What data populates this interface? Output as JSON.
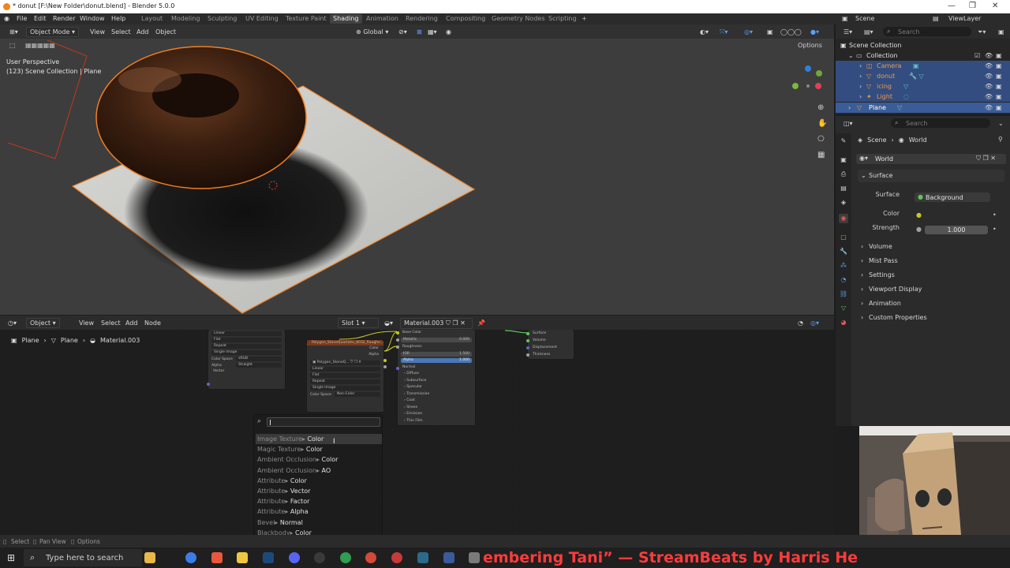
{
  "window": {
    "title": "* donut [F:\\New Folder\\donut.blend] - Blender 5.0.0"
  },
  "menu": {
    "items": [
      "File",
      "Edit",
      "Render",
      "Window",
      "Help"
    ],
    "workspaces": [
      "Layout",
      "Modeling",
      "Sculpting",
      "UV Editing",
      "Texture Paint",
      "Shading",
      "Animation",
      "Rendering",
      "Compositing",
      "Geometry Nodes",
      "Scripting"
    ],
    "active_workspace": "Shading",
    "scene_label": "Scene",
    "view_layer_label": "ViewLayer"
  },
  "viewport": {
    "mode": "Object Mode",
    "menus": [
      "View",
      "Select",
      "Add",
      "Object"
    ],
    "transform_orientation": "Global",
    "options_label": "Options",
    "overlay_title": "User Perspective",
    "overlay_subtitle": "(123) Scene Collection | Plane"
  },
  "node_editor": {
    "mode": "Object",
    "menus": [
      "View",
      "Select",
      "Add",
      "Node"
    ],
    "slot": "Slot 1",
    "material": "Material.003",
    "breadcrumb": [
      "Plane",
      "Plane",
      "Material.003"
    ],
    "node1_fields": [
      "Linear",
      "Flat",
      "Repeat",
      "Single Image"
    ],
    "node1_color_space_label": "Color Space",
    "node1_color_space": "sRGB",
    "node1_alpha_label": "Alpha",
    "node1_alpha": "Straight",
    "node1_vector": "Vector",
    "node2_title": "Polygon_StoneQuartzite_8032_Roughn...",
    "node2_image": "Polygon_StoneQ...",
    "node2_outputs": [
      "Color",
      "Alpha"
    ],
    "node2_fields": [
      "Linear",
      "Flat",
      "Repeat",
      "Single Image"
    ],
    "node2_color_space_label": "Color Space",
    "node2_color_space": "Non-Color",
    "bsdf_rows": [
      "Base Color",
      "Metallic",
      "Roughness",
      "IOR",
      "Alpha",
      "Normal"
    ],
    "bsdf_metallic": "0.000",
    "bsdf_ior": "1.500",
    "bsdf_alpha": "1.000",
    "bsdf_panels": [
      "Diffuse",
      "Subsurface",
      "Specular",
      "Transmission",
      "Coat",
      "Sheen",
      "Emission",
      "Thin Film"
    ],
    "output_sockets": [
      "Surface",
      "Volume",
      "Displacement",
      "Thickness"
    ]
  },
  "search_popup": {
    "query": "",
    "results": [
      {
        "category": "Image Texture",
        "name": "Color"
      },
      {
        "category": "Magic Texture",
        "name": "Color"
      },
      {
        "category": "Ambient Occlusion",
        "name": "Color"
      },
      {
        "category": "Ambient Occlusion",
        "name": "AO"
      },
      {
        "category": "Attribute",
        "name": "Color"
      },
      {
        "category": "Attribute",
        "name": "Vector"
      },
      {
        "category": "Attribute",
        "name": "Factor"
      },
      {
        "category": "Attribute",
        "name": "Alpha"
      },
      {
        "category": "Bevel",
        "name": "Normal"
      },
      {
        "category": "Blackbody",
        "name": "Color"
      }
    ],
    "separator": "▸"
  },
  "outliner": {
    "search_placeholder": "Search",
    "root": "Scene Collection",
    "collection": "Collection",
    "objects": [
      "Camera",
      "donut",
      "icing",
      "Light",
      "Plane"
    ]
  },
  "properties": {
    "search_placeholder": "Search",
    "breadcrumb": [
      "Scene",
      "World"
    ],
    "world_name": "World",
    "surface_section": "Surface",
    "surface_label": "Surface",
    "surface_value": "Background",
    "color_label": "Color",
    "strength_label": "Strength",
    "strength_value": "1.000",
    "collapsed_sections": [
      "Volume",
      "Mist Pass",
      "Settings",
      "Viewport Display",
      "Animation",
      "Custom Properties"
    ]
  },
  "statusbar": {
    "items": [
      "Select",
      "Pan View",
      "Options"
    ]
  },
  "taskbar": {
    "search_placeholder": "Type here to search",
    "ticker": "embering Tani” — StreamBeats by Harris He"
  },
  "colors": {
    "accent_blue": "#3a5d9a",
    "node_header_orange": "#7a3a1a",
    "selection_orange": "#f07f22",
    "ticker_red": "#ff3b3b"
  }
}
